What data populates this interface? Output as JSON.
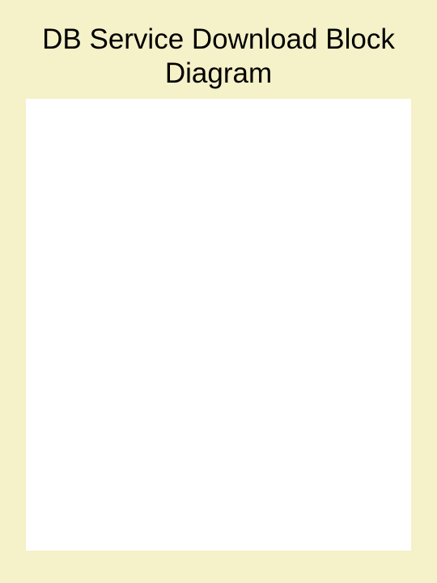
{
  "title_line1": "DB Service Download Block",
  "title_line2": "Diagram"
}
